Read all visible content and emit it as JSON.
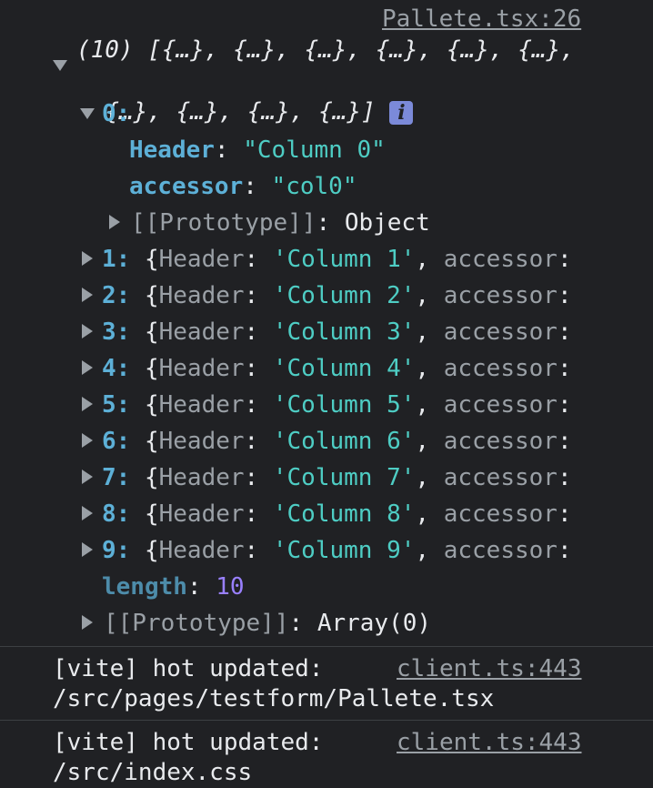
{
  "log_source": "Pallete.tsx:26",
  "array_preview_line1": "(10) [{…}, {…}, {…}, {…}, {…}, {…},",
  "array_preview_line2": "{…}, {…}, {…}, {…}]",
  "info_badge": "i",
  "item0": {
    "index_label": "0:",
    "header_key": "Header",
    "header_value": "\"Column 0\"",
    "accessor_key": "accessor",
    "accessor_value": "\"col0\"",
    "prototype_label": "[[Prototype]]",
    "prototype_value": "Object"
  },
  "items": [
    {
      "index": "1:",
      "value": "'Column 1'"
    },
    {
      "index": "2:",
      "value": "'Column 2'"
    },
    {
      "index": "3:",
      "value": "'Column 3'"
    },
    {
      "index": "4:",
      "value": "'Column 4'"
    },
    {
      "index": "5:",
      "value": "'Column 5'"
    },
    {
      "index": "6:",
      "value": "'Column 6'"
    },
    {
      "index": "7:",
      "value": "'Column 7'"
    },
    {
      "index": "8:",
      "value": "'Column 8'"
    },
    {
      "index": "9:",
      "value": "'Column 9'"
    }
  ],
  "collapsed_header_key": "Header",
  "collapsed_accessor_key": "accessor",
  "length_key": "length",
  "length_value": "10",
  "array_prototype_label": "[[Prototype]]",
  "array_prototype_value": "Array(0)",
  "messages": [
    {
      "text": "[vite] hot updated:",
      "path": "/src/pages/testform/Pallete.tsx",
      "source": "client.ts:443"
    },
    {
      "text": "[vite] hot updated:",
      "path": "/src/index.css",
      "source": "client.ts:443"
    }
  ],
  "colors": {
    "background": "#202124",
    "key": "#5db0d7",
    "string": "#4ecdc4",
    "number": "#9980ff"
  }
}
